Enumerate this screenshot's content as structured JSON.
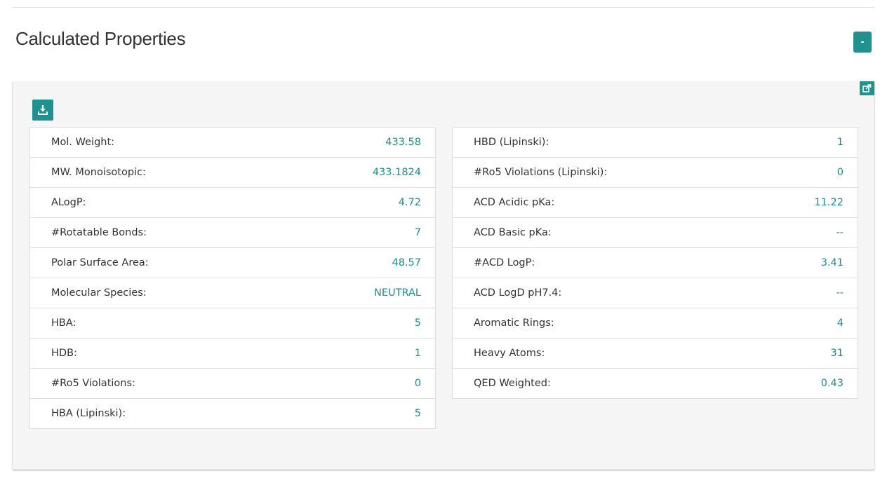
{
  "section": {
    "title": "Calculated Properties",
    "collapse_label": "-"
  },
  "colors": {
    "accent": "#1f9190",
    "value_text": "#1a8f8f",
    "panel_bg": "#f5f5f5"
  },
  "icons": {
    "download": "download-icon",
    "share": "share-icon"
  },
  "left_table": [
    {
      "label": "Mol. Weight:",
      "value": "433.58"
    },
    {
      "label": "MW. Monoisotopic:",
      "value": "433.1824"
    },
    {
      "label": "ALogP:",
      "value": "4.72"
    },
    {
      "label": "#Rotatable Bonds:",
      "value": "7"
    },
    {
      "label": "Polar Surface Area:",
      "value": "48.57"
    },
    {
      "label": "Molecular Species:",
      "value": "NEUTRAL"
    },
    {
      "label": "HBA:",
      "value": "5"
    },
    {
      "label": "HDB:",
      "value": "1"
    },
    {
      "label": "#Ro5 Violations:",
      "value": "0"
    },
    {
      "label": "HBA (Lipinski):",
      "value": "5"
    }
  ],
  "right_table": [
    {
      "label": "HBD (Lipinski):",
      "value": "1"
    },
    {
      "label": "#Ro5 Violations (Lipinski):",
      "value": "0"
    },
    {
      "label": "ACD Acidic pKa:",
      "value": "11.22"
    },
    {
      "label": "ACD Basic pKa:",
      "value": "--"
    },
    {
      "label": "#ACD LogP:",
      "value": "3.41"
    },
    {
      "label": "ACD LogD pH7.4:",
      "value": "--"
    },
    {
      "label": "Aromatic Rings:",
      "value": "4"
    },
    {
      "label": "Heavy Atoms:",
      "value": "31"
    },
    {
      "label": "QED Weighted:",
      "value": "0.43"
    }
  ]
}
